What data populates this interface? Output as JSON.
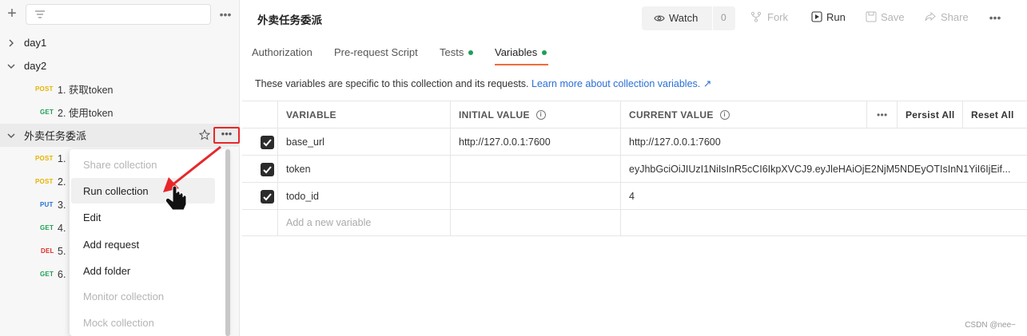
{
  "sidebar": {
    "collections": [
      {
        "label": "day1"
      },
      {
        "label": "day2"
      },
      {
        "label": "外卖任务委派"
      }
    ],
    "day2_requests": [
      {
        "method": "POST",
        "label": "1. 获取token"
      },
      {
        "method": "GET",
        "label": "2. 使用token"
      }
    ],
    "collection_requests": [
      {
        "method": "POST",
        "label": "1."
      },
      {
        "method": "POST",
        "label": "2."
      },
      {
        "method": "PUT",
        "label": "3."
      },
      {
        "method": "GET",
        "label": "4."
      },
      {
        "method": "DEL",
        "label": "5."
      },
      {
        "method": "GET",
        "label": "6."
      }
    ]
  },
  "context_menu": {
    "items": [
      {
        "label": "Share collection",
        "enabled": false
      },
      {
        "label": "Run collection",
        "enabled": true
      },
      {
        "label": "Edit",
        "enabled": true
      },
      {
        "label": "Add request",
        "enabled": true
      },
      {
        "label": "Add folder",
        "enabled": true
      },
      {
        "label": "Monitor collection",
        "enabled": false
      },
      {
        "label": "Mock collection",
        "enabled": false
      }
    ]
  },
  "header": {
    "title": "外卖任务委派",
    "watch_label": "Watch",
    "watch_count": "0",
    "fork_label": "Fork",
    "run_label": "Run",
    "save_label": "Save",
    "share_label": "Share"
  },
  "tabs": [
    {
      "label": "Authorization",
      "dot": false
    },
    {
      "label": "Pre-request Script",
      "dot": false
    },
    {
      "label": "Tests",
      "dot": true
    },
    {
      "label": "Variables",
      "dot": true,
      "active": true
    }
  ],
  "info": {
    "text": "These variables are specific to this collection and its requests.",
    "link": "Learn more about collection variables. ↗"
  },
  "table": {
    "headers": {
      "variable": "VARIABLE",
      "initial": "INITIAL VALUE",
      "current": "CURRENT VALUE",
      "persist_all": "Persist All",
      "reset_all": "Reset All"
    },
    "rows": [
      {
        "checked": true,
        "variable": "base_url",
        "initial": "http://127.0.0.1:7600",
        "current": "http://127.0.0.1:7600"
      },
      {
        "checked": true,
        "variable": "token",
        "initial": "",
        "current": "eyJhbGciOiJIUzI1NiIsInR5cCI6IkpXVCJ9.eyJleHAiOjE2NjM5NDEyOTIsInN1YiI6IjEif..."
      },
      {
        "checked": true,
        "variable": "todo_id",
        "initial": "",
        "current": "4"
      }
    ],
    "add_placeholder": "Add a new variable"
  },
  "watermark": "CSDN @nee~",
  "colors": {
    "accent": "#f26b3a",
    "highlight_box": "#e8262a",
    "link": "#2b6fd6"
  }
}
